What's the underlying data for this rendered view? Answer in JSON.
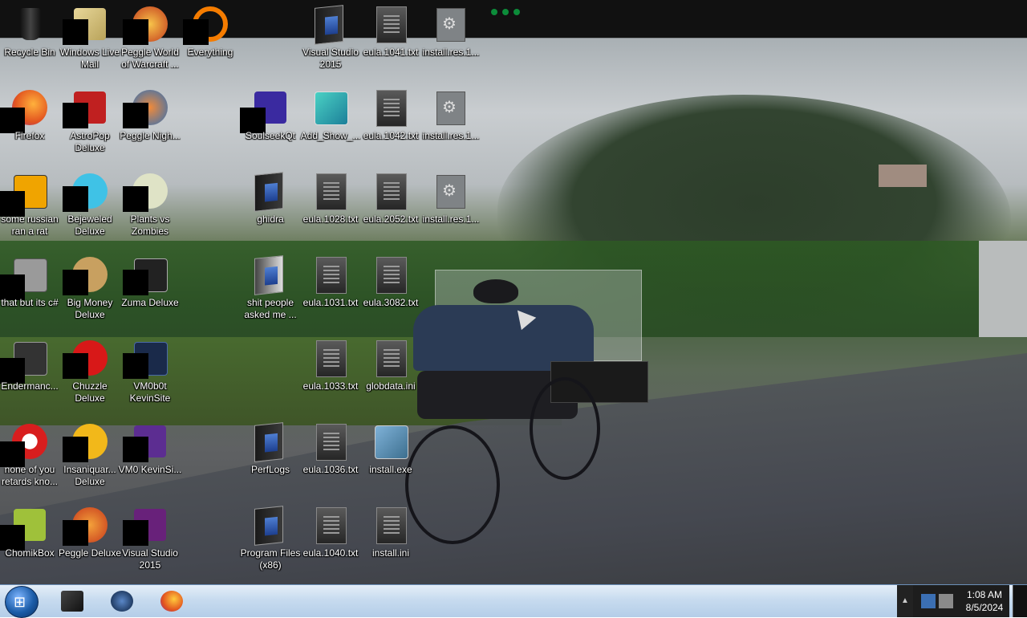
{
  "desktop": {
    "icons": [
      {
        "label": "Recycle Bin",
        "icon": "recycle-bin-icon",
        "masked": false
      },
      {
        "label": "Windows Live Mail",
        "icon": "windows-live-mail-icon",
        "masked": true
      },
      {
        "label": "Peggle World of Warcraft ...",
        "icon": "peggle-wow-icon",
        "masked": true
      },
      {
        "label": "Everything",
        "icon": "everything-search-icon",
        "masked": true
      },
      {
        "label": "Visual Studio 2015",
        "icon": "folder-shortcut-icon",
        "masked": false
      },
      {
        "label": "eula.1041.txt",
        "icon": "text-file-icon",
        "masked": false
      },
      {
        "label": "install.res.1...",
        "icon": "dll-settings-file-icon",
        "masked": false
      },
      {
        "label": "Firefox",
        "icon": "firefox-icon",
        "masked": true
      },
      {
        "label": "AstroPop Deluxe",
        "icon": "astropop-icon",
        "masked": true
      },
      {
        "label": "Peggle Nigh...",
        "icon": "peggle-nights-icon",
        "masked": true
      },
      {
        "label": "SoulseekQt",
        "icon": "soulseek-icon",
        "masked": true
      },
      {
        "label": "Add_Show_...",
        "icon": "registry-file-icon",
        "masked": false
      },
      {
        "label": "eula.1042.txt",
        "icon": "text-file-icon",
        "masked": false
      },
      {
        "label": "install.res.1...",
        "icon": "dll-settings-file-icon",
        "masked": false
      },
      {
        "label": "some russian ran a rat",
        "icon": "de-app-icon",
        "masked": true
      },
      {
        "label": "Bejeweled Deluxe",
        "icon": "bejeweled-icon",
        "masked": true
      },
      {
        "label": "Plants vs Zombies",
        "icon": "plants-vs-zombies-icon",
        "masked": true
      },
      {
        "label": "ghidra",
        "icon": "folder-shortcut-icon",
        "masked": false
      },
      {
        "label": "eula.1028.txt",
        "icon": "text-file-icon",
        "masked": false
      },
      {
        "label": "eula.2052.txt",
        "icon": "text-file-icon",
        "masked": false
      },
      {
        "label": "install.res.1...",
        "icon": "dll-settings-file-icon",
        "masked": false
      },
      {
        "label": "that but its c#",
        "icon": "stacked-windows-icon",
        "masked": true
      },
      {
        "label": "Big Money Deluxe",
        "icon": "big-money-icon",
        "masked": true
      },
      {
        "label": "Zuma Deluxe",
        "icon": "zuma-icon",
        "masked": true
      },
      {
        "label": "shit people asked me ...",
        "icon": "folder-shortcut-icon",
        "masked": false
      },
      {
        "label": "eula.1031.txt",
        "icon": "text-file-icon",
        "masked": false
      },
      {
        "label": "eula.3082.txt",
        "icon": "text-file-icon",
        "masked": false
      },
      {
        "label": "Endermanc...",
        "icon": "console-app-icon",
        "masked": true
      },
      {
        "label": "Chuzzle Deluxe",
        "icon": "chuzzle-icon",
        "masked": true
      },
      {
        "label": "VM0b0t KevinSite",
        "icon": "vm-shortcut-icon",
        "masked": true
      },
      {
        "label": "eula.1033.txt",
        "icon": "text-file-icon",
        "masked": false
      },
      {
        "label": "globdata.ini",
        "icon": "settings-file-icon",
        "masked": false
      },
      {
        "label": "none of you retards kno...",
        "icon": "red-circle-app-icon",
        "masked": true
      },
      {
        "label": "Insaniquar... Deluxe",
        "icon": "insaniquarium-icon",
        "masked": true
      },
      {
        "label": "VM0 KevinSi...",
        "icon": "visual-studio-icon",
        "masked": true
      },
      {
        "label": "PerfLogs",
        "icon": "folder-shortcut-icon",
        "masked": false
      },
      {
        "label": "eula.1036.txt",
        "icon": "text-file-icon",
        "masked": false
      },
      {
        "label": "install.exe",
        "icon": "installer-exe-icon",
        "masked": false
      },
      {
        "label": "ChomikBox",
        "icon": "chomikbox-icon",
        "masked": true
      },
      {
        "label": "Peggle Deluxe",
        "icon": "peggle-icon",
        "masked": true
      },
      {
        "label": "Visual Studio 2015",
        "icon": "visual-studio-icon",
        "masked": true
      },
      {
        "label": "Program Files (x86)",
        "icon": "folder-shortcut-icon",
        "masked": false
      },
      {
        "label": "eula.1040.txt",
        "icon": "text-file-icon",
        "masked": false
      },
      {
        "label": "install.ini",
        "icon": "settings-file-icon",
        "masked": false
      }
    ]
  },
  "taskbar": {
    "start_icon": "windows-start-orb-icon",
    "pinned": [
      {
        "icon": "dark-app-icon"
      },
      {
        "icon": "globe-app-icon"
      },
      {
        "icon": "firefox-icon"
      }
    ],
    "tray_expand_glyph": "▲",
    "clock_time": "1:08 AM",
    "clock_date": "8/5/2024"
  },
  "colors": {
    "taskbar_light": "#c7dbef",
    "tray_dark": "#1d1d1d",
    "label_text": "#ffffff"
  }
}
